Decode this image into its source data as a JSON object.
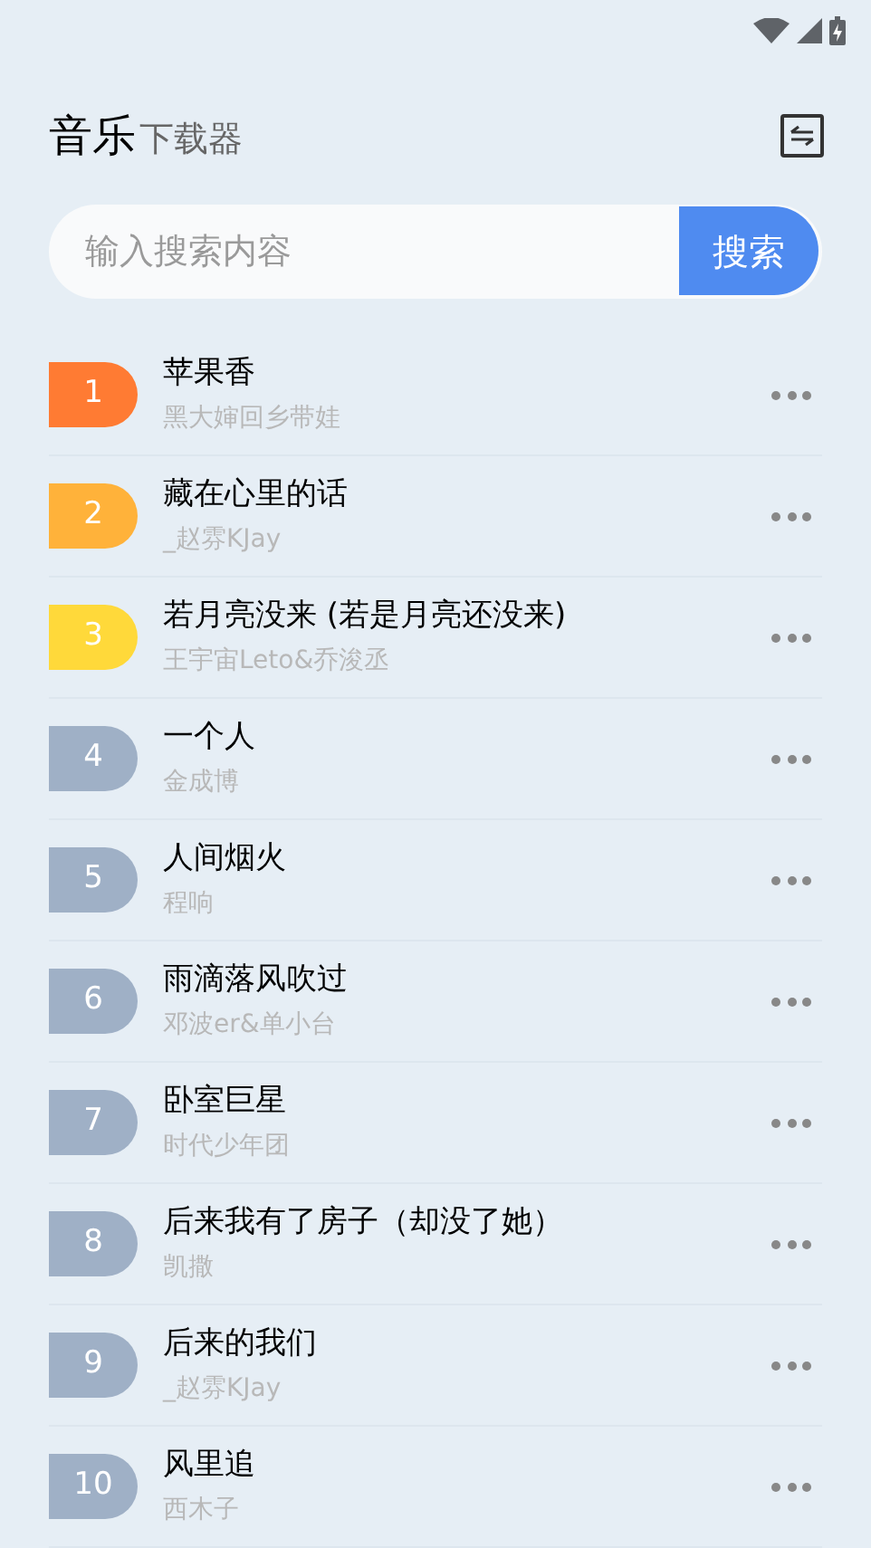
{
  "header": {
    "title": "音乐",
    "subtitle": "下载器"
  },
  "search": {
    "placeholder": "输入搜索内容",
    "button": "搜索"
  },
  "songs": [
    {
      "rank": "1",
      "color": "#ff7b33",
      "title": "苹果香",
      "artist": "黑大婶回乡带娃"
    },
    {
      "rank": "2",
      "color": "#ffb23a",
      "title": "藏在心里的话",
      "artist": "_赵雰KJay"
    },
    {
      "rank": "3",
      "color": "#ffd93a",
      "title": "若月亮没来 (若是月亮还没来)",
      "artist": "王宇宙Leto&乔浚丞"
    },
    {
      "rank": "4",
      "color": "#9fb0c6",
      "title": "一个人",
      "artist": "金成博"
    },
    {
      "rank": "5",
      "color": "#9fb0c6",
      "title": "人间烟火",
      "artist": "程响"
    },
    {
      "rank": "6",
      "color": "#9fb0c6",
      "title": "雨滴落风吹过",
      "artist": "邓波er&单小台"
    },
    {
      "rank": "7",
      "color": "#9fb0c6",
      "title": "卧室巨星",
      "artist": "时代少年团"
    },
    {
      "rank": "8",
      "color": "#9fb0c6",
      "title": "后来我有了房子（却没了她）",
      "artist": "凯撒"
    },
    {
      "rank": "9",
      "color": "#9fb0c6",
      "title": "后来的我们",
      "artist": "_赵雰KJay"
    },
    {
      "rank": "10",
      "color": "#9fb0c6",
      "title": "风里追",
      "artist": "西木子"
    }
  ]
}
